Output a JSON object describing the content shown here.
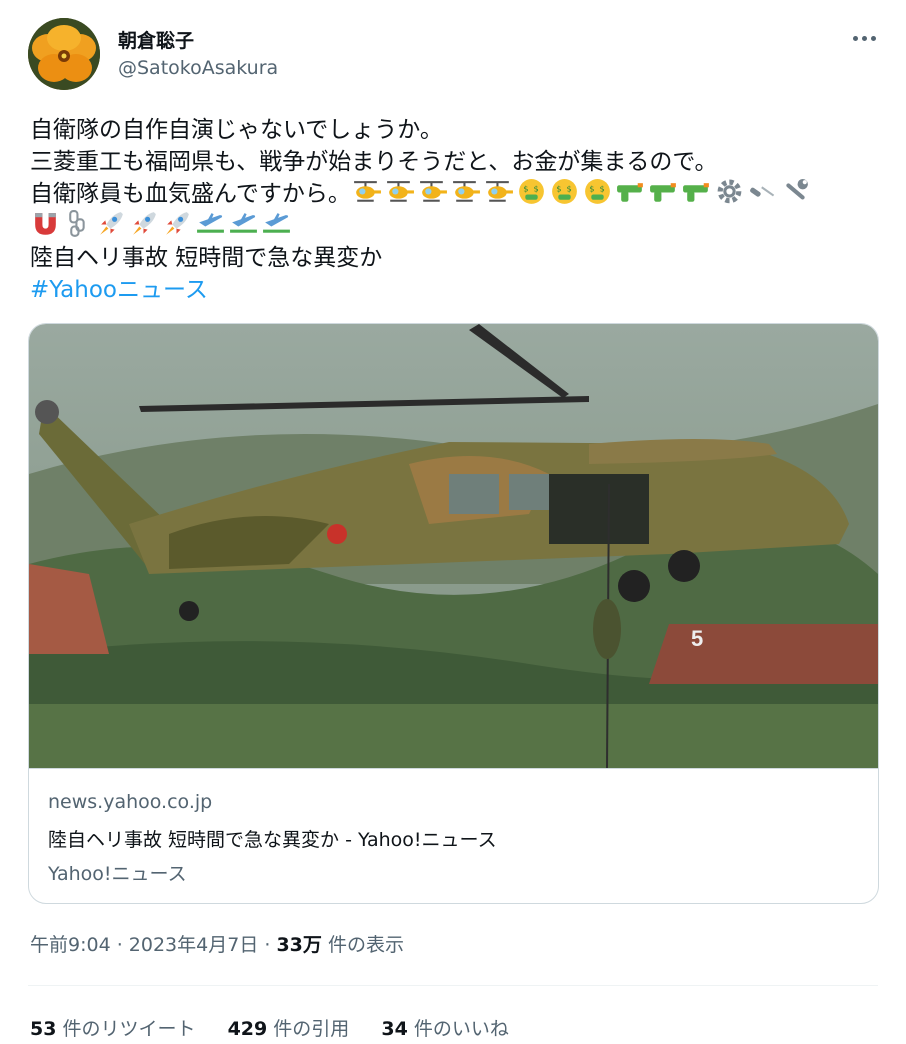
{
  "author": {
    "display_name": "朝倉聡子",
    "handle": "@SatokoAsakura",
    "avatar_icon": "pansy-flower-avatar"
  },
  "more_icon": "more-dots-icon",
  "tweet": {
    "line1": "自衛隊の自作自演じゃないでしょうか。",
    "line2": "三菱重工も福岡県も、戦争が始まりそうだと、お金が集まるので。",
    "line3": "自衛隊員も血気盛んですから。",
    "emoji_row1": [
      "helicopter",
      "helicopter",
      "helicopter",
      "helicopter",
      "helicopter",
      "money-mouth-face",
      "money-mouth-face",
      "money-mouth-face",
      "water-pistol",
      "water-pistol",
      "water-pistol",
      "gear",
      "screwdriver",
      "wrench"
    ],
    "emoji_row2": [
      "magnet",
      "chains",
      "rocket",
      "rocket",
      "rocket",
      "airplane-departure",
      "airplane-departure",
      "airplane-departure"
    ],
    "headline": "陸自ヘリ事故 短時間で急な異変か",
    "hashtag": "#Yahooニュース"
  },
  "card": {
    "image_alt_icon": "military-helicopter-photo",
    "domain": "news.yahoo.co.jp",
    "title": "陸自ヘリ事故 短時間で急な異変か - Yahoo!ニュース",
    "source": "Yahoo!ニュース"
  },
  "timestamp": {
    "time": "午前9:04",
    "date": "2023年4月7日",
    "views_count": "33万",
    "views_label": "件の表示"
  },
  "stats": {
    "retweets_count": "53",
    "retweets_label": "件のリツイート",
    "quotes_count": "429",
    "quotes_label": "件の引用",
    "likes_count": "34",
    "likes_label": "件のいいね"
  },
  "colors": {
    "text_primary": "#0f1419",
    "text_secondary": "#536471",
    "link": "#1d9bf0",
    "border": "#cfd9de"
  }
}
